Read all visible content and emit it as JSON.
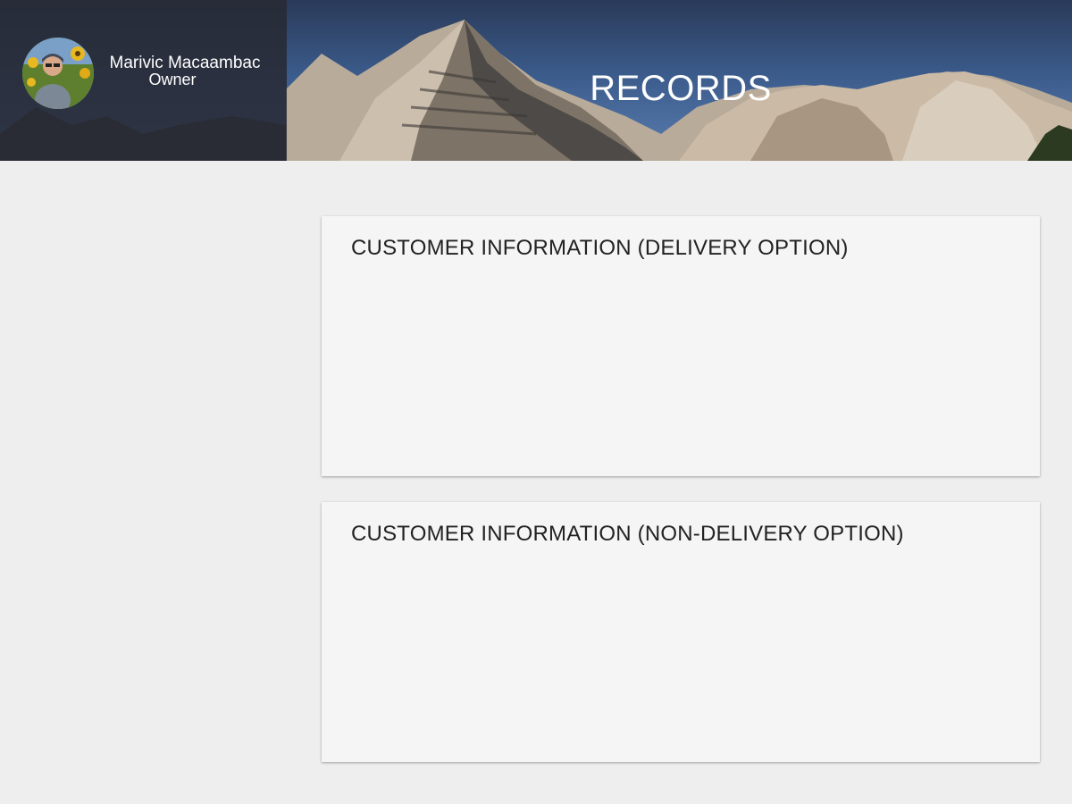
{
  "header": {
    "title": "RECORDS",
    "user": {
      "name": "Marivic Macaambac",
      "role": "Owner"
    }
  },
  "cards": [
    {
      "title": "CUSTOMER INFORMATION (DELIVERY OPTION)"
    },
    {
      "title": "CUSTOMER INFORMATION (NON-DELIVERY OPTION)"
    }
  ],
  "colors": {
    "page_background": "#eeeeee",
    "card_background": "#f5f5f5",
    "profile_panel": "#282a34",
    "header_sky": "#3a5a8a"
  }
}
